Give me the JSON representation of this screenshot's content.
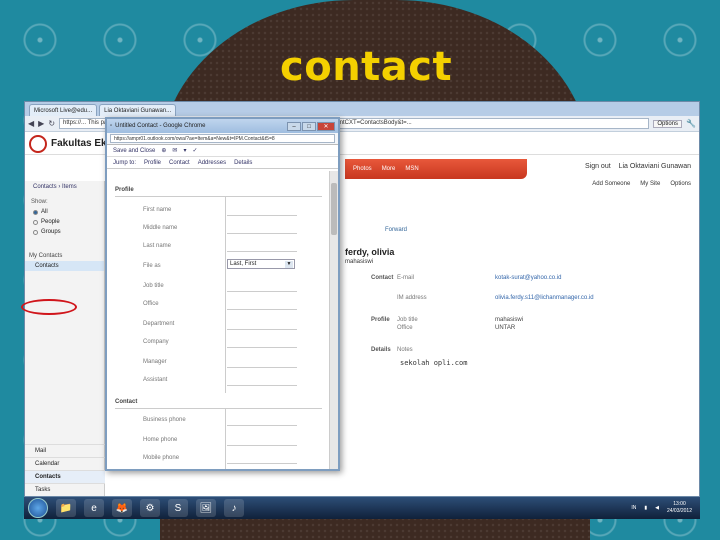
{
  "slide": {
    "title": "contact"
  },
  "outer_browser": {
    "tabs": [
      "Microsoft Live@edu...",
      "Lia Oktaviani Gunawan..."
    ],
    "address": "https://... This page is in ...",
    "address_tail": "...ntCXT=ContactsBody&t=...",
    "options_label": "Options"
  },
  "owa": {
    "faculty": "Fakultas Eko...",
    "nav_tabs": [
      "Photos",
      "More",
      "MSN"
    ],
    "sign_out": "Sign out",
    "user": "Lia Oktaviani Gunawan",
    "crumb": [
      "Contacts",
      "Items"
    ],
    "show_label": "Show:",
    "show_options": [
      "All",
      "People",
      "Groups"
    ],
    "my_contacts": "My Contacts",
    "contacts_item": "Contacts",
    "nav_links": [
      "Mail",
      "Calendar",
      "Contacts",
      "Tasks"
    ],
    "right_menu": [
      "Add Someone",
      "My Site",
      "Options"
    ],
    "detail": {
      "forward": "Forward",
      "name": "ferdy, olivia",
      "role": "mahasiswi",
      "contact_label": "Contact",
      "email_label": "E-mail",
      "email_value": "kotak-surat@yahoo.co.id",
      "im_label": "IM address",
      "im_value": "olivia.ferdy.s11@lichanmanager.co.id",
      "profile_label": "Profile",
      "job_label": "Job title",
      "job_value": "mahasiswi",
      "office_label": "Office",
      "office_value": "UNTAR",
      "details_label": "Details",
      "notes_label": "Notes",
      "notes_value": "sekolah opli.com"
    }
  },
  "popup": {
    "title": "Untitled Contact - Google Chrome",
    "address": "https://ampr01.outlook.com/owa/?ae=Item&a=New&t=IPM.Contact&t5=8",
    "toolbar1": [
      "Save and Close",
      "⊕",
      "✉",
      "▾",
      "✓"
    ],
    "toolbar2": [
      "Jump to:",
      "Profile",
      "Contact",
      "Addresses",
      "Details"
    ],
    "profile_header": "Profile",
    "profile_fields": [
      "First name",
      "Middle name",
      "Last name",
      "File as",
      "Job title",
      "Office",
      "Department",
      "Company",
      "Manager",
      "Assistant"
    ],
    "file_as_value": "Last, First",
    "contact_header": "Contact",
    "contact_fields": [
      "Business phone",
      "Home phone",
      "Mobile phone"
    ]
  },
  "taskbar": {
    "icons": [
      "📁",
      "e",
      "🦊",
      "⚙",
      "S",
      "🖼",
      "♪"
    ],
    "lang": "IN",
    "time": "13:00",
    "date": "24/03/2012"
  }
}
